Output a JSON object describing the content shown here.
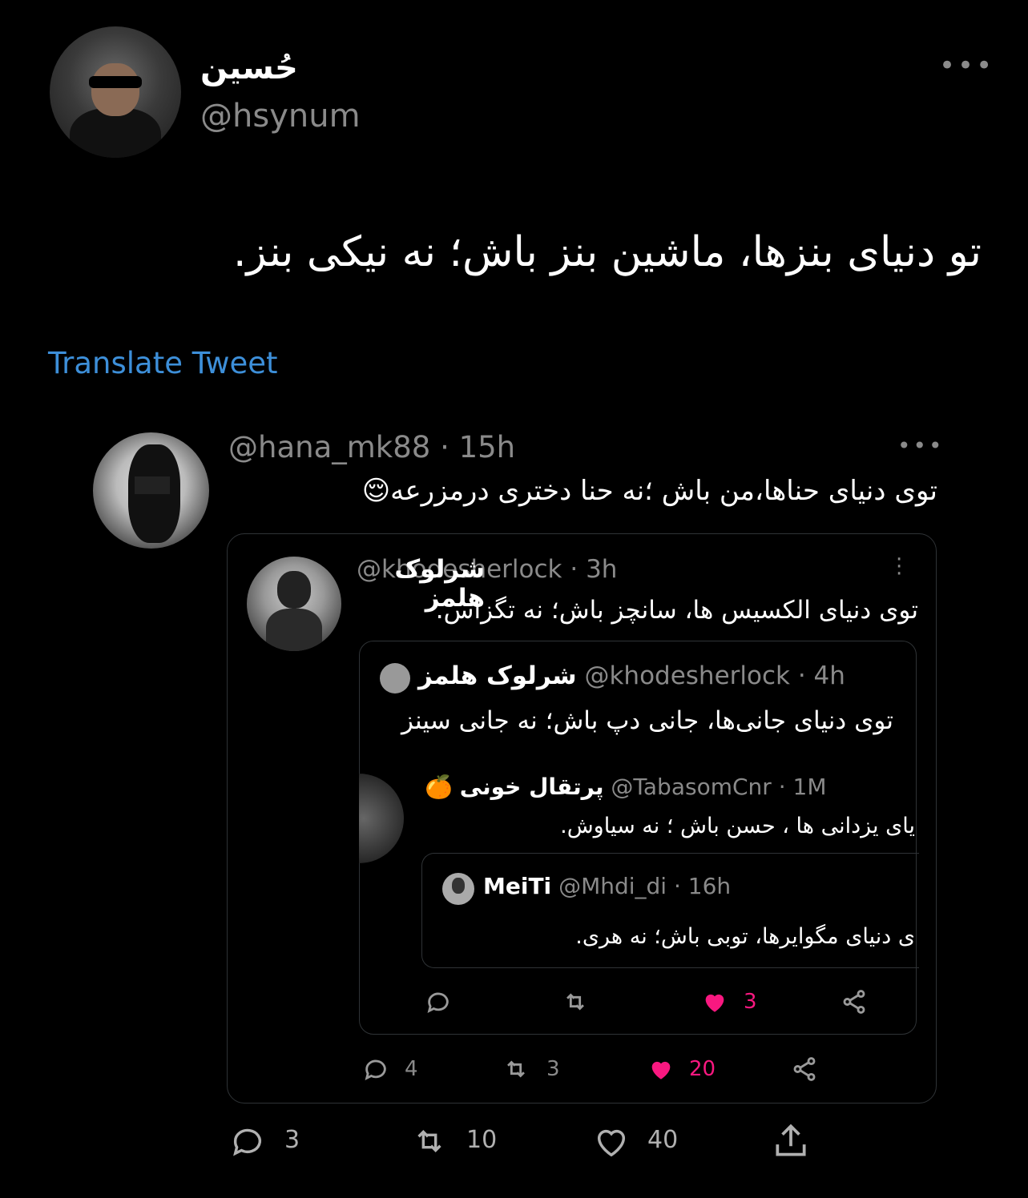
{
  "main_tweet": {
    "display_name": "حُسین",
    "handle": "@hsynum",
    "text": "تو دنیای بنزها، ماشین بنز باش؛ نه نیکی بنز.",
    "translate_label": "Translate Tweet",
    "stats": {
      "replies": "3",
      "retweets": "10",
      "likes": "40"
    }
  },
  "reply_tweet": {
    "handle": "@hana_mk88",
    "time": "· 15h",
    "text": "توی دنیای حناها،من باش ؛نه حنا دختری درمزرعه😌",
    "stats": {
      "replies": "4",
      "retweets": "3",
      "likes": "20"
    }
  },
  "quoted_1": {
    "display_name": "شرلوک هلمز",
    "handle": "@khodesherlock",
    "time": "· 3h",
    "text": "توی دنیای الکسیس ها، سانچز باش؛ نه تگزاس.",
    "stats": {
      "likes": "3"
    }
  },
  "quoted_2": {
    "display_name": "شرلوک هلمز",
    "handle": "@khodesherlock",
    "time": "· 4h",
    "text": "توی دنیای جانی‌ها، جانی دپ باش؛ نه جانی سینز"
  },
  "quoted_3": {
    "display_name": "پرتقال خونی",
    "emoji": "🍊",
    "handle": "@TabasomCnr",
    "time": "· 1M",
    "text": "یای یزدانی ها ، حسن باش ؛ نه سیاوش."
  },
  "quoted_4": {
    "display_name": "MeiTi",
    "handle": "@Mhdi_di",
    "time": "· 16h",
    "text": "ی دنیای مگوایرها، توبی باش؛ نه هری."
  },
  "colors": {
    "link": "#3d8fd9",
    "like_pink": "#f91880",
    "muted": "#7a7a7a"
  }
}
